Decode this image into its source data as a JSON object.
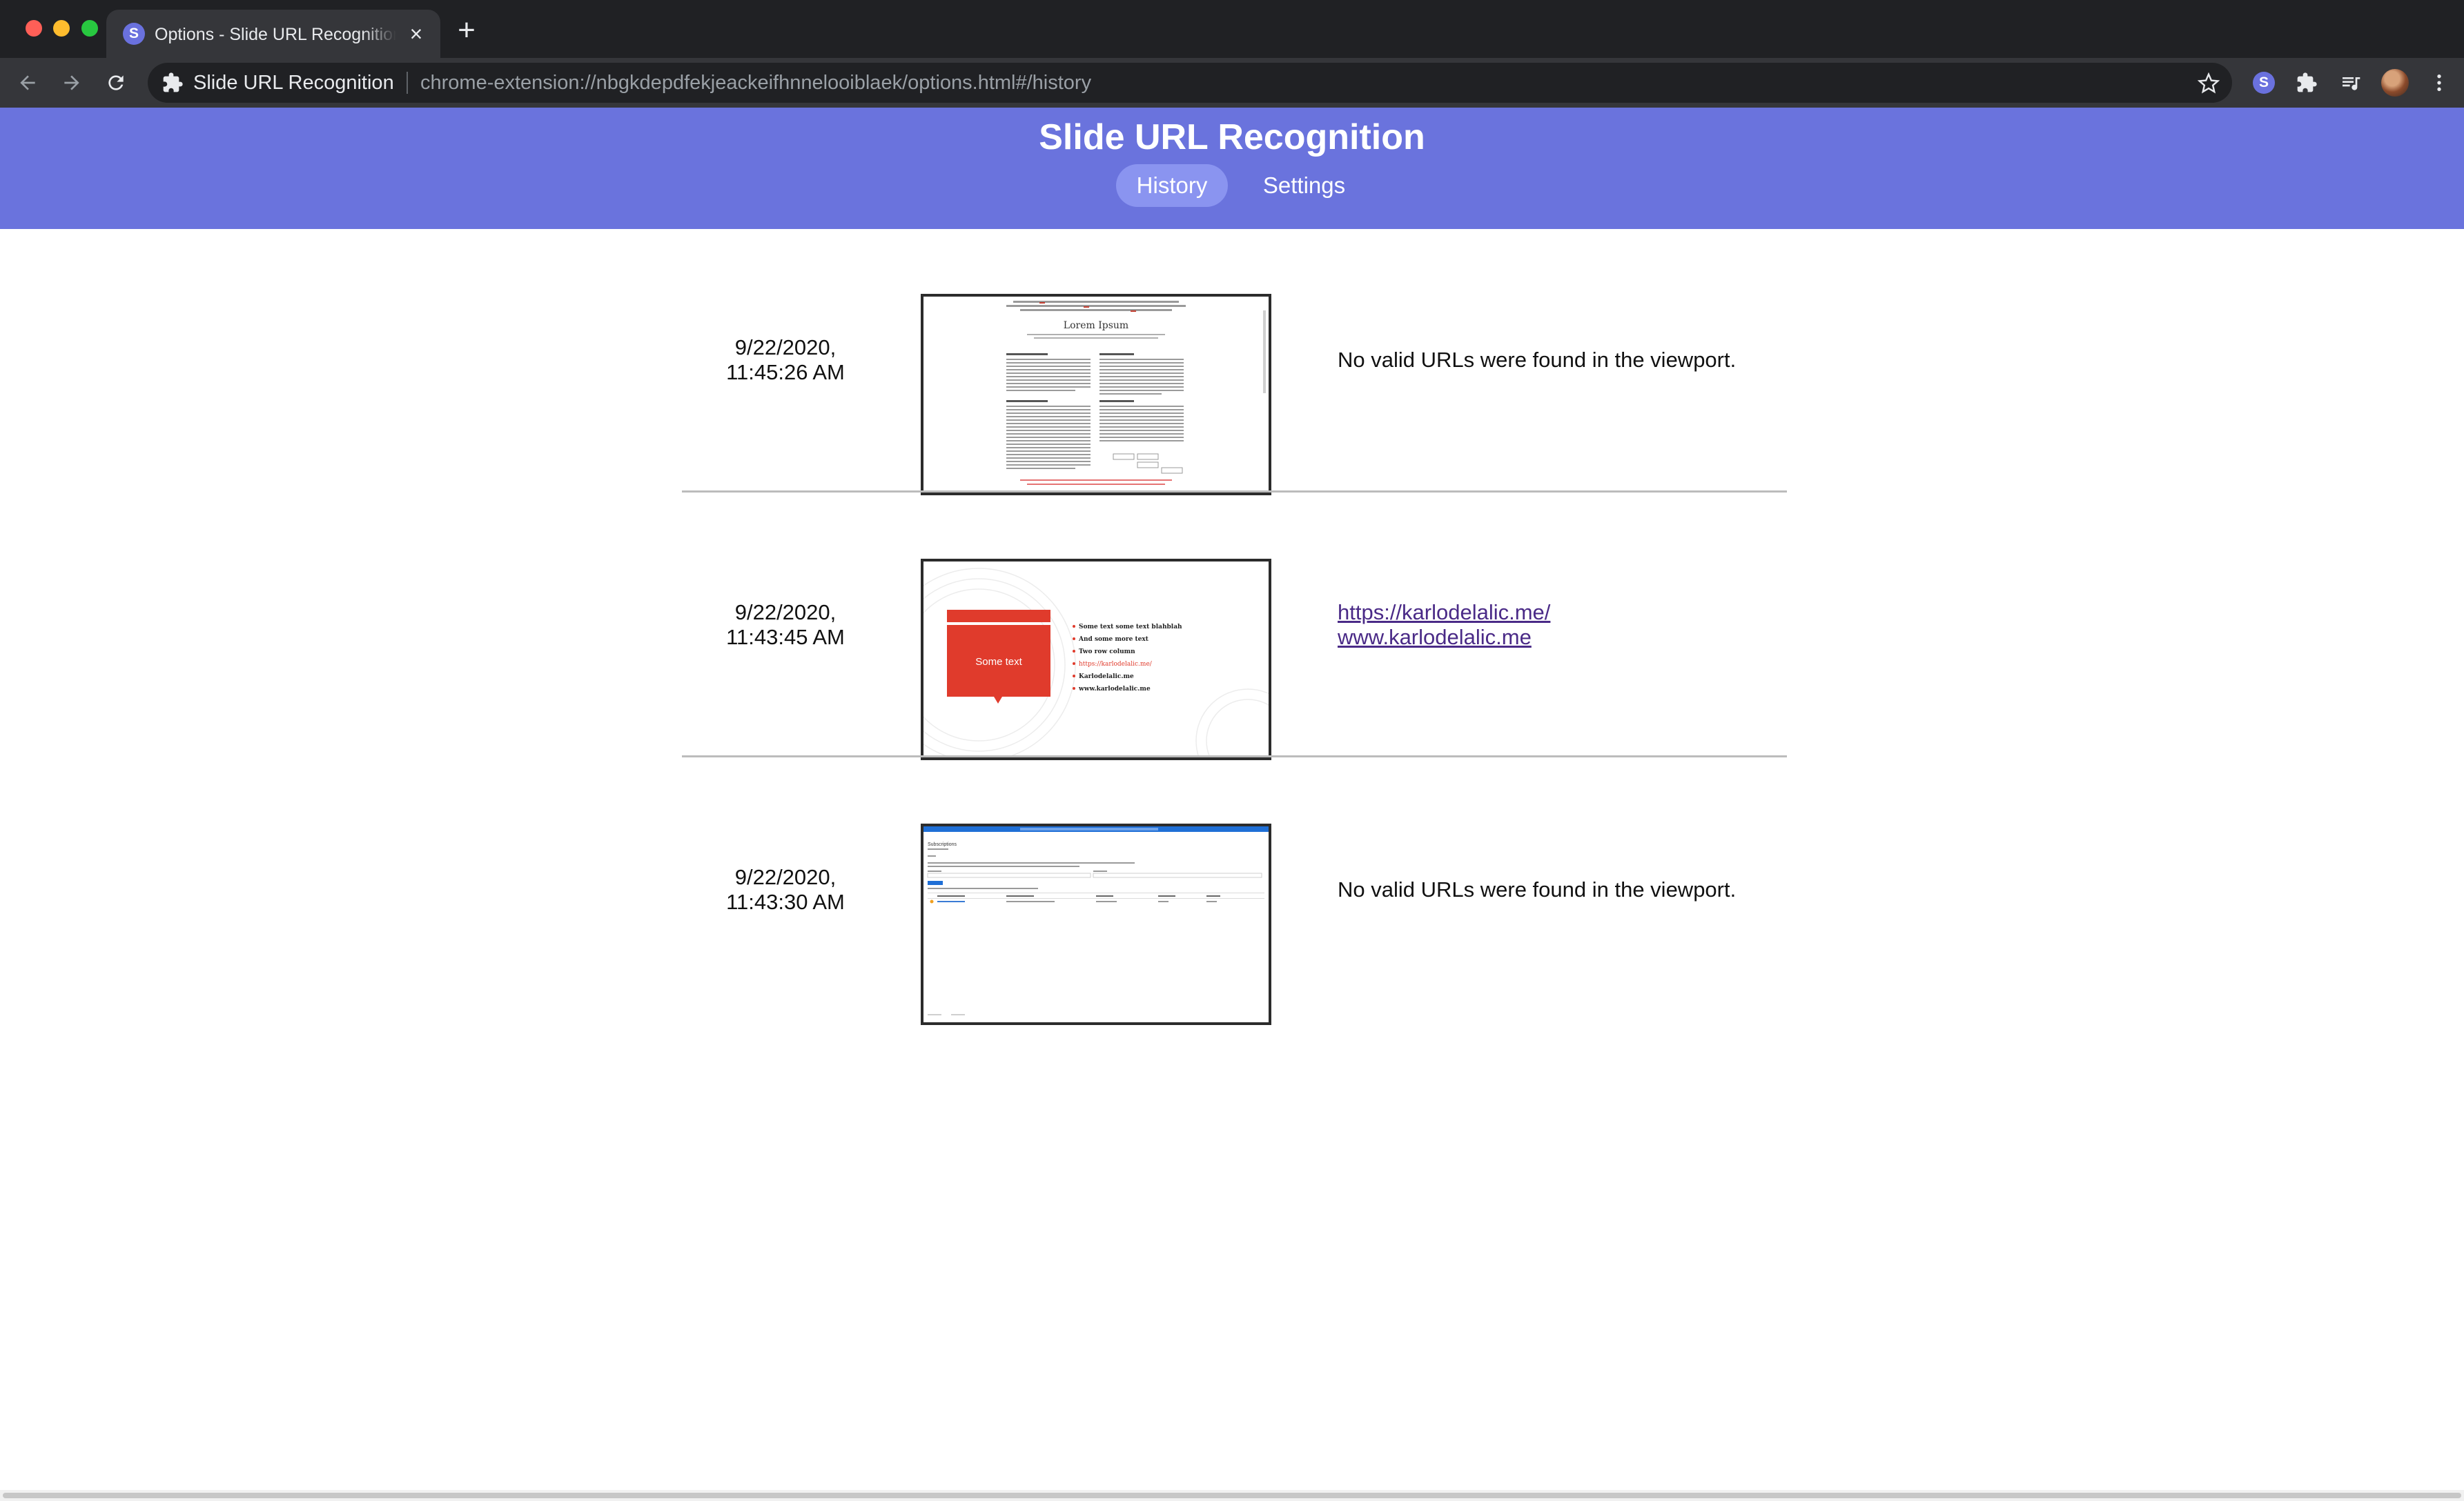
{
  "browser": {
    "tab_title": "Options - Slide URL Recognition",
    "omnibox_site": "Slide URL Recognition",
    "omnibox_url": "chrome-extension://nbgkdepdfekjeackeifhnnelooiblaek/options.html#/history",
    "tab_favicon_letter": "S",
    "extension_badge_letter": "S"
  },
  "app": {
    "title": "Slide URL Recognition",
    "nav": {
      "history": "History",
      "settings": "Settings",
      "active": "History"
    },
    "colors": {
      "header_bg": "#6a73dd",
      "active_tab_bg": "#8a94f0",
      "link": "#4a2a87"
    }
  },
  "history": [
    {
      "date": "9/22/2020,",
      "time": "11:45:26 AM",
      "thumbnail": "lorem-ipsum-webpage",
      "thumb_text": {
        "title": "Lorem Ipsum"
      },
      "message": "No valid URLs were found in the viewport.",
      "urls": []
    },
    {
      "date": "9/22/2020,",
      "time": "11:43:45 AM",
      "thumbnail": "presentation-slide",
      "thumb_text": {
        "callout": "Some text",
        "bullets": [
          "Some text some text blahblah",
          "And some more text",
          "Two row column",
          "https://karlodelalic.me/",
          "Karlodelalic.me",
          "www.karlodelalic.me"
        ]
      },
      "message": "",
      "urls": [
        "https://karlodelalic.me/",
        "www.karlodelalic.me"
      ]
    },
    {
      "date": "9/22/2020,",
      "time": "11:43:30 AM",
      "thumbnail": "azure-portal-subscriptions",
      "thumb_text": {
        "title": "Subscriptions"
      },
      "message": "No valid URLs were found in the viewport.",
      "urls": []
    }
  ]
}
